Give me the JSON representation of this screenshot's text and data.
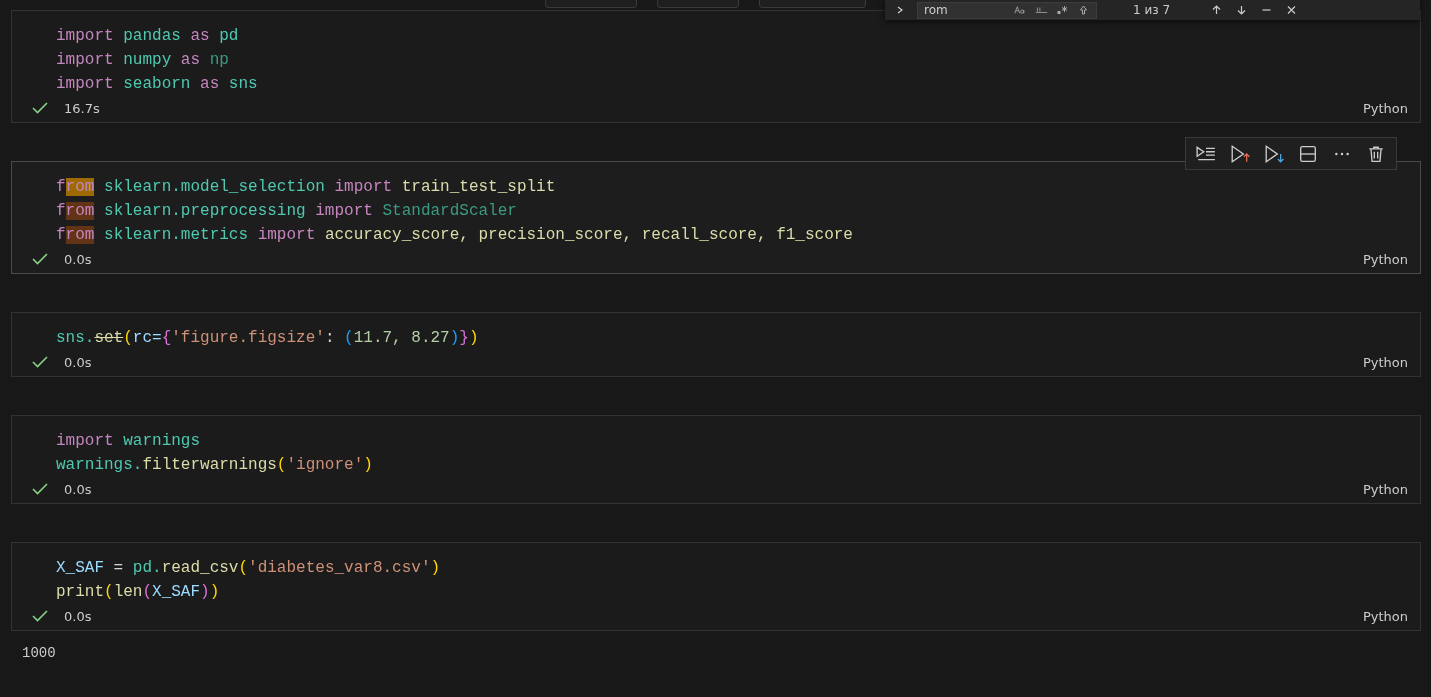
{
  "find_widget": {
    "value": "rom",
    "match_count": "1 из 7"
  },
  "cells": [
    {
      "hovered": false,
      "succeeded": true,
      "time": "16.7s",
      "language": "Python",
      "lines": [
        [
          {
            "t": "import ",
            "kind": "keyword"
          },
          {
            "t": "pandas ",
            "kind": "module"
          },
          {
            "t": "as ",
            "kind": "keyword"
          },
          {
            "t": "pd",
            "kind": "module"
          }
        ],
        [
          {
            "t": "import ",
            "kind": "keyword"
          },
          {
            "t": "numpy ",
            "kind": "module"
          },
          {
            "t": "as ",
            "kind": "keyword"
          },
          {
            "t": "np",
            "kind": "unused"
          }
        ],
        [
          {
            "t": "import ",
            "kind": "keyword"
          },
          {
            "t": "seaborn ",
            "kind": "module"
          },
          {
            "t": "as ",
            "kind": "keyword"
          },
          {
            "t": "sns",
            "kind": "module"
          }
        ]
      ]
    },
    {
      "hovered": true,
      "succeeded": true,
      "time": "0.0s",
      "language": "Python",
      "lines": [
        [
          {
            "t": "f",
            "kind": "keyword"
          },
          {
            "t": "rom",
            "kind": "keyword",
            "highlighted": true,
            "selected": true
          },
          {
            "t": " sklearn.model_selection ",
            "kind": "module"
          },
          {
            "t": "import ",
            "kind": "keyword"
          },
          {
            "t": "train_test_split",
            "kind": "function"
          }
        ],
        [
          {
            "t": "f",
            "kind": "keyword"
          },
          {
            "t": "rom",
            "kind": "keyword",
            "highlighted": true,
            "selected": false
          },
          {
            "t": " sklearn.preprocessing ",
            "kind": "module"
          },
          {
            "t": "import ",
            "kind": "keyword"
          },
          {
            "t": "StandardScaler",
            "kind": "unused"
          }
        ],
        [
          {
            "t": "f",
            "kind": "keyword"
          },
          {
            "t": "rom",
            "kind": "keyword",
            "highlighted": true,
            "selected": false
          },
          {
            "t": " sklearn.metrics ",
            "kind": "module"
          },
          {
            "t": "import ",
            "kind": "keyword"
          },
          {
            "t": "accuracy_score, precision_score, recall_score, f1_score",
            "kind": "function"
          }
        ]
      ]
    },
    {
      "hovered": false,
      "succeeded": true,
      "time": "0.0s",
      "language": "Python",
      "lines": [
        [
          {
            "t": "sns.",
            "kind": "module"
          },
          {
            "t": "set",
            "kind": "deprecated"
          },
          {
            "t": "(",
            "kind": "bracket1"
          },
          {
            "t": "rc=",
            "kind": "variable"
          },
          {
            "t": "{",
            "kind": "bracket2"
          },
          {
            "t": "'figure.figsize'",
            "kind": "string"
          },
          {
            "t": ": ",
            "kind": "plain"
          },
          {
            "t": "(",
            "kind": "bracket3"
          },
          {
            "t": "11.7, 8.27",
            "kind": "number"
          },
          {
            "t": ")",
            "kind": "bracket3"
          },
          {
            "t": "}",
            "kind": "bracket2"
          },
          {
            "t": ")",
            "kind": "bracket1"
          }
        ]
      ]
    },
    {
      "hovered": false,
      "succeeded": true,
      "time": "0.0s",
      "language": "Python",
      "lines": [
        [
          {
            "t": "import ",
            "kind": "keyword"
          },
          {
            "t": "warnings",
            "kind": "module"
          }
        ],
        [
          {
            "t": "warnings.",
            "kind": "module"
          },
          {
            "t": "filterwarnings",
            "kind": "function"
          },
          {
            "t": "(",
            "kind": "bracket1"
          },
          {
            "t": "'ignore'",
            "kind": "string"
          },
          {
            "t": ")",
            "kind": "bracket1"
          }
        ]
      ]
    },
    {
      "hovered": false,
      "succeeded": true,
      "time": "0.0s",
      "language": "Python",
      "output": "1000",
      "lines": [
        [
          {
            "t": "X_SAF",
            "kind": "variable"
          },
          {
            "t": " = ",
            "kind": "plain"
          },
          {
            "t": "pd.",
            "kind": "module"
          },
          {
            "t": "read_csv",
            "kind": "function"
          },
          {
            "t": "(",
            "kind": "bracket1"
          },
          {
            "t": "'diabetes_var8.csv'",
            "kind": "string"
          },
          {
            "t": ")",
            "kind": "bracket1"
          }
        ],
        [
          {
            "t": "print",
            "kind": "function"
          },
          {
            "t": "(",
            "kind": "bracket1"
          },
          {
            "t": "len",
            "kind": "function"
          },
          {
            "t": "(",
            "kind": "bracket2"
          },
          {
            "t": "X_SAF",
            "kind": "variable"
          },
          {
            "t": ")",
            "kind": "bracket2"
          },
          {
            "t": ")",
            "kind": "bracket1"
          }
        ]
      ]
    }
  ]
}
